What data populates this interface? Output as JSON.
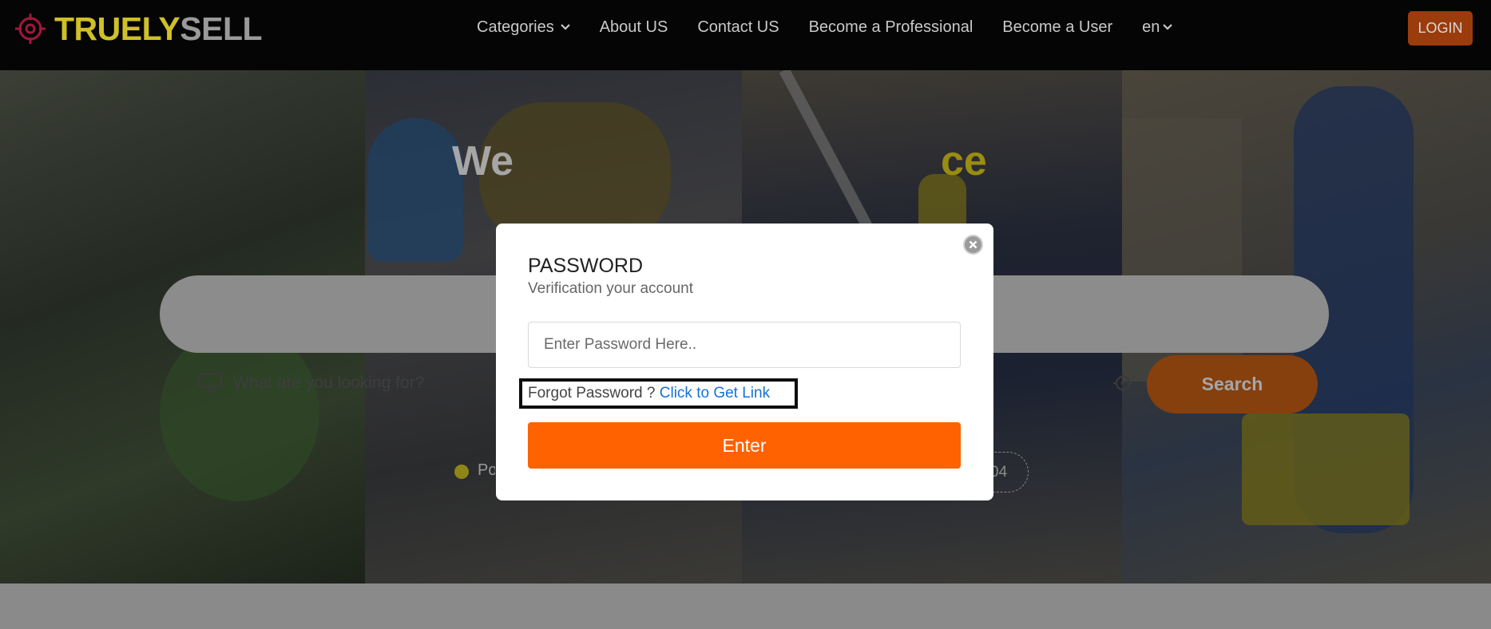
{
  "header": {
    "logo": {
      "part_a": "TRUELY",
      "part_b": "SELL",
      "color_a": "#cfc02a",
      "color_b": "#9a9a9a",
      "mark_color": "#a3163e"
    },
    "nav": [
      {
        "label": "Categories",
        "has_dropdown": true
      },
      {
        "label": "About US"
      },
      {
        "label": "Contact US"
      },
      {
        "label": "Become a Professional"
      },
      {
        "label": "Become a User"
      },
      {
        "label": "en",
        "has_dropdown": true
      }
    ],
    "login_label": "LOGIN"
  },
  "hero": {
    "title_start": "We",
    "title_end": "ce",
    "search_placeholder": "What are you looking for?",
    "search_button": "Search",
    "popular_label": "Po",
    "tag_partial": "04"
  },
  "modal": {
    "title": "PASSWORD",
    "subtitle": "Verification your account",
    "password_placeholder": "Enter Password Here..",
    "forgot_text": "Forgot Password ?",
    "forgot_link": "Click to Get Link",
    "enter_button": "Enter",
    "accent_color": "#ff6200",
    "link_color": "#1672d6"
  }
}
